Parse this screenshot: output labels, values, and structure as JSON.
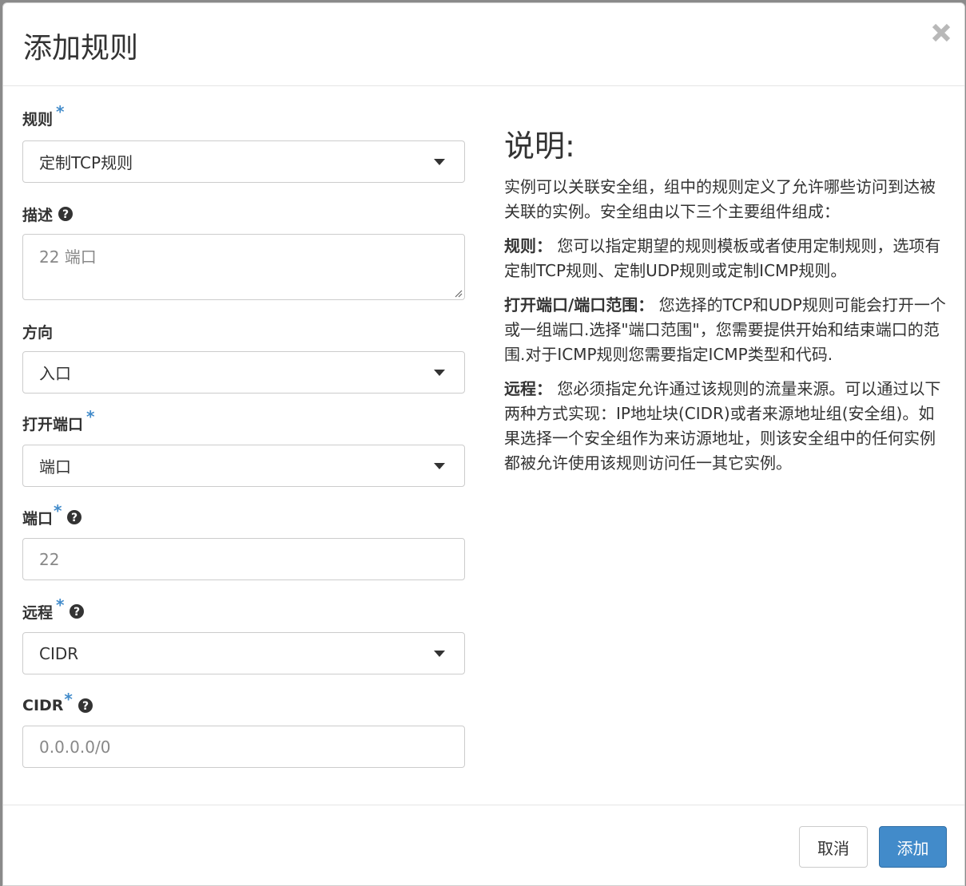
{
  "modal": {
    "title": "添加规则",
    "close_icon": "close-icon"
  },
  "form": {
    "rule": {
      "label": "规则",
      "required": "*",
      "value": "定制TCP规则"
    },
    "description": {
      "label": "描述",
      "placeholder": "22 端口"
    },
    "direction": {
      "label": "方向",
      "value": "入口"
    },
    "open_port": {
      "label": "打开端口",
      "required": "*",
      "value": "端口"
    },
    "port": {
      "label": "端口",
      "required": "*",
      "placeholder": "22"
    },
    "remote": {
      "label": "远程",
      "required": "*",
      "value": "CIDR"
    },
    "cidr": {
      "label": "CIDR",
      "required": "*",
      "placeholder": "0.0.0.0/0"
    }
  },
  "help_text": {
    "title": "说明:",
    "intro": "实例可以关联安全组，组中的规则定义了允许哪些访问到达被关联的实例。安全组由以下三个主要组件组成：",
    "rule_term": "规则：",
    "rule_desc": "您可以指定期望的规则模板或者使用定制规则，选项有定制TCP规则、定制UDP规则或定制ICMP规则。",
    "port_term": "打开端口/端口范围：",
    "port_desc": "您选择的TCP和UDP规则可能会打开一个或一组端口.选择\"端口范围\"，您需要提供开始和结束端口的范围.对于ICMP规则您需要指定ICMP类型和代码.",
    "remote_term": "远程：",
    "remote_desc": "您必须指定允许通过该规则的流量来源。可以通过以下两种方式实现：IP地址块(CIDR)或者来源地址组(安全组)。如果选择一个安全组作为来访源地址，则该安全组中的任何实例都被允许使用该规则访问任一其它实例。"
  },
  "footer": {
    "cancel_label": "取消",
    "add_label": "添加"
  },
  "colors": {
    "primary": "#428bca",
    "required_star": "#428bca",
    "border": "#cccccc"
  }
}
